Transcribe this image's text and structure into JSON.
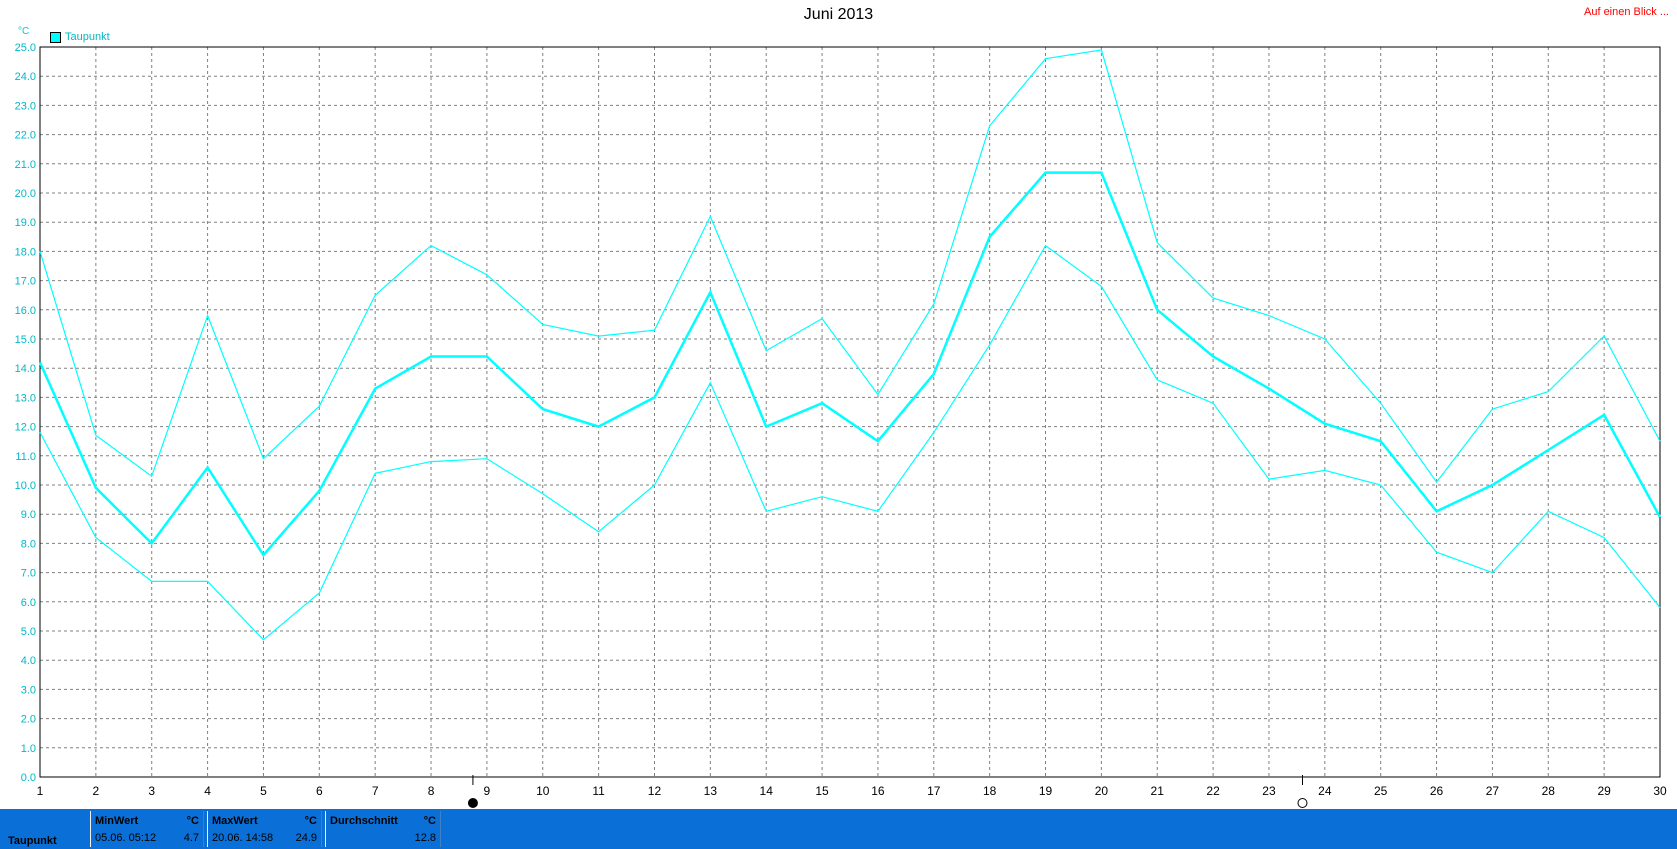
{
  "title": "Juni 2013",
  "top_link": "Auf einen Blick ...",
  "unit": "°C",
  "legend_label": "Taupunkt",
  "colors": {
    "series": "#00ffff",
    "grid": "#808080",
    "stats_bar": "#0a70d8",
    "link": "#ff0000"
  },
  "stats": {
    "row_label": "Taupunkt",
    "min": {
      "header": "MinWert",
      "unit": "°C",
      "date": "05.06.  05:12",
      "value": "4.7"
    },
    "max": {
      "header": "MaxWert",
      "unit": "°C",
      "date": "20.06.  14:58",
      "value": "24.9"
    },
    "avg": {
      "header": "Durchschnitt",
      "unit": "°C",
      "value": "12.8"
    }
  },
  "chart_data": {
    "type": "line",
    "title": "Juni 2013",
    "ylabel": "°C",
    "ylim": [
      0,
      25
    ],
    "yticks": [
      "0.0",
      "1.0",
      "2.0",
      "3.0",
      "4.0",
      "5.0",
      "6.0",
      "7.0",
      "8.0",
      "9.0",
      "10.0",
      "11.0",
      "12.0",
      "13.0",
      "14.0",
      "15.0",
      "16.0",
      "17.0",
      "18.0",
      "19.0",
      "20.0",
      "21.0",
      "22.0",
      "23.0",
      "24.0",
      "25.0"
    ],
    "x": [
      1,
      2,
      3,
      4,
      5,
      6,
      7,
      8,
      9,
      10,
      11,
      12,
      13,
      14,
      15,
      16,
      17,
      18,
      19,
      20,
      21,
      22,
      23,
      24,
      25,
      26,
      27,
      28,
      29,
      30
    ],
    "xticks": [
      "1",
      "2",
      "3",
      "4",
      "5",
      "6",
      "7",
      "8",
      "9",
      "10",
      "11",
      "12",
      "13",
      "14",
      "15",
      "16",
      "17",
      "18",
      "19",
      "20",
      "21",
      "22",
      "23",
      "24",
      "25",
      "26",
      "27",
      "28",
      "29",
      "30"
    ],
    "grid": true,
    "legend": "top-left",
    "moon_phases": [
      {
        "day": 8.75,
        "phase": "full-moon"
      },
      {
        "day": 23.6,
        "phase": "new-moon"
      }
    ],
    "series": [
      {
        "name": "Taupunkt",
        "role": "max",
        "values": [
          18.0,
          11.7,
          10.3,
          15.8,
          10.9,
          12.7,
          16.5,
          18.2,
          17.2,
          15.5,
          15.1,
          15.3,
          19.2,
          14.6,
          15.7,
          13.1,
          16.2,
          22.3,
          24.6,
          24.9,
          18.3,
          16.4,
          15.8,
          15.0,
          12.8,
          10.1,
          12.6,
          13.2,
          15.1,
          11.5
        ]
      },
      {
        "name": "Taupunkt",
        "role": "avg",
        "values": [
          14.2,
          9.9,
          8.0,
          10.6,
          7.6,
          9.8,
          13.3,
          14.4,
          14.4,
          12.6,
          12.0,
          13.0,
          16.6,
          12.0,
          12.8,
          11.5,
          13.8,
          18.5,
          20.7,
          20.7,
          16.0,
          14.4,
          13.3,
          12.1,
          11.5,
          9.1,
          10.0,
          11.2,
          12.4,
          8.9
        ]
      },
      {
        "name": "Taupunkt",
        "role": "min",
        "values": [
          11.8,
          8.2,
          6.7,
          6.7,
          4.7,
          6.3,
          10.4,
          10.8,
          10.9,
          9.7,
          8.4,
          10.0,
          13.5,
          9.1,
          9.6,
          9.1,
          11.8,
          14.8,
          18.2,
          16.8,
          13.6,
          12.8,
          10.2,
          10.5,
          10.0,
          7.7,
          7.0,
          9.1,
          8.2,
          5.8
        ]
      }
    ]
  }
}
